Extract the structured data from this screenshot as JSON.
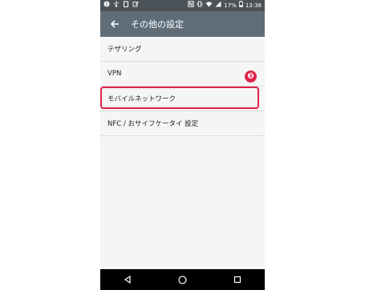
{
  "status_bar": {
    "battery": "17%",
    "time": "13:36"
  },
  "app_bar": {
    "title": "その他の設定"
  },
  "list_items": [
    {
      "label": "テザリング"
    },
    {
      "label": "VPN"
    },
    {
      "label": "モバイルネットワーク"
    },
    {
      "label": "NFC / おサイフケータイ 設定"
    }
  ],
  "annotation": {
    "badge": "❷",
    "color": "#e0234a"
  },
  "icons": {
    "status_left": [
      "info-icon",
      "usb-icon",
      "clipboard-icon",
      "edit-icon"
    ],
    "status_right": [
      "nfc-icon",
      "vibrate-icon",
      "wifi-icon",
      "signal-icon",
      "battery-icon"
    ],
    "nav": [
      "back-triangle-icon",
      "home-circle-icon",
      "recents-square-icon"
    ]
  }
}
